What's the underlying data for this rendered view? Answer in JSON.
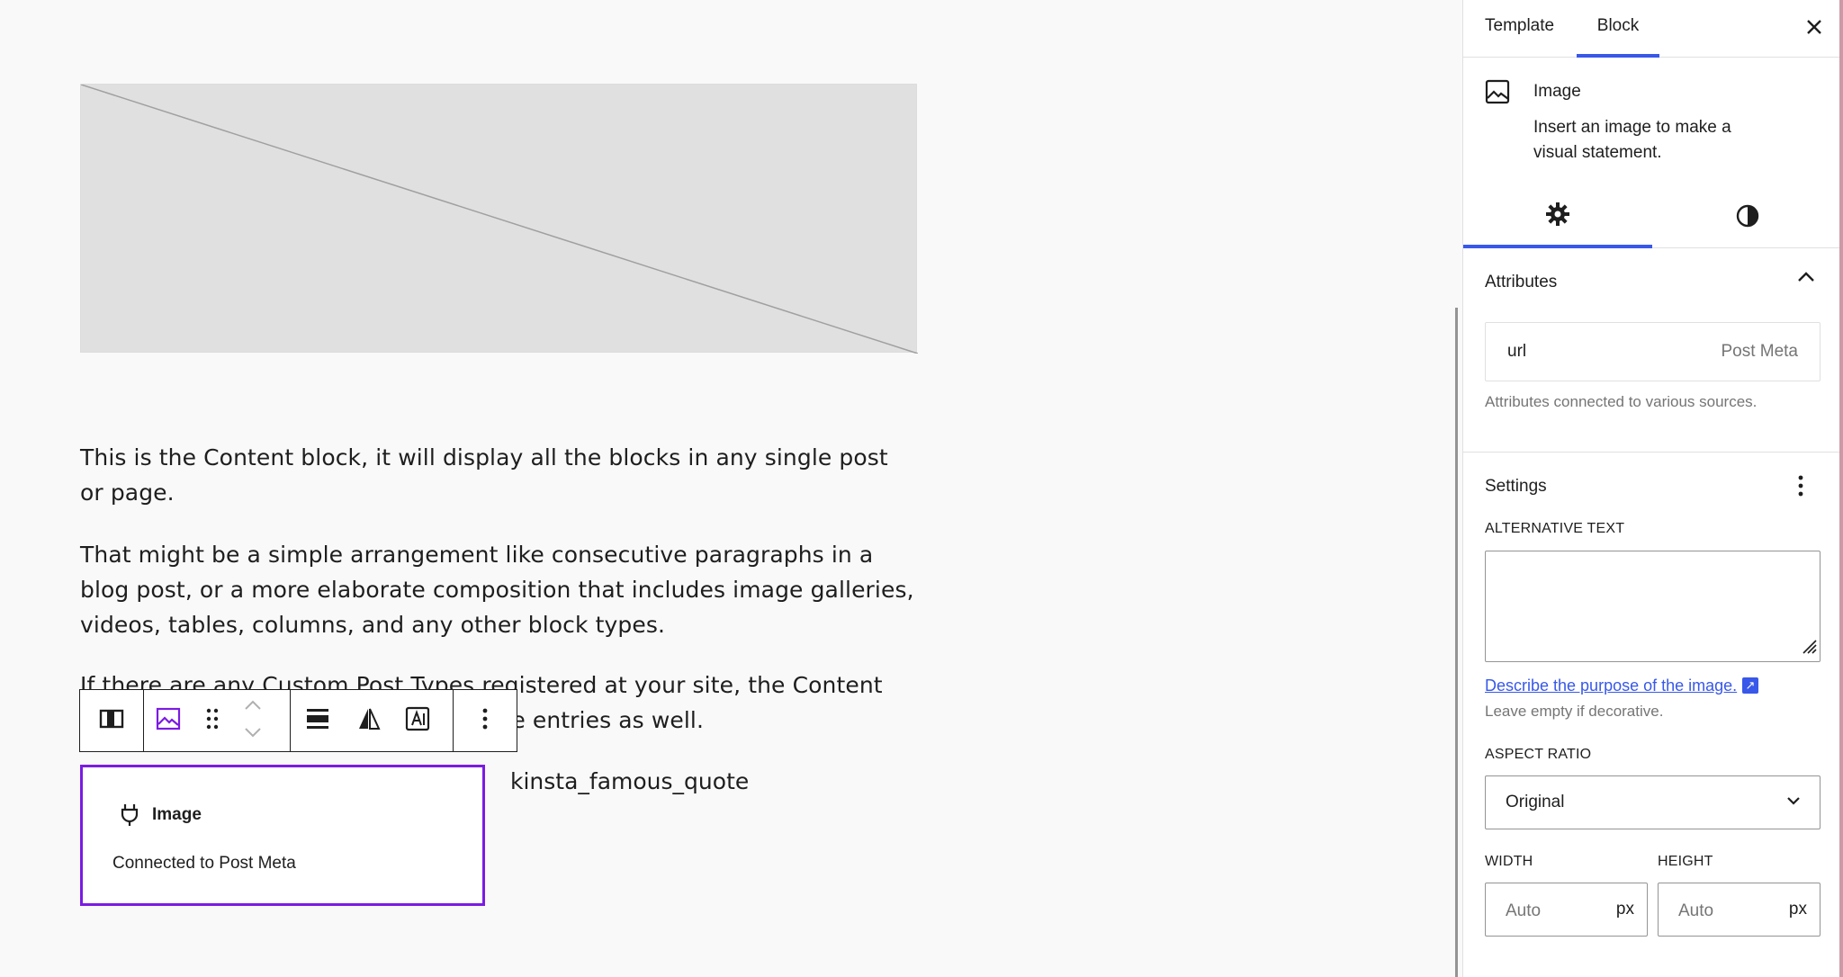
{
  "canvas": {
    "paragraphs": [
      "This is the Content block, it will display all the blocks in any single post or page.",
      "That might be a simple arrangement like consecutive paragraphs in a blog post, or a more elaborate composition that includes image galleries, videos, tables, columns, and any other block types.",
      "If there are any Custom Post Types registered at your site, the Content block can display the contents of those entries as well."
    ],
    "quote_label": "kinsta_famous_quote",
    "image_block": {
      "title": "Image",
      "description": "Connected to Post Meta"
    },
    "toolbar": {
      "icons": [
        "parent-block-icon",
        "image-icon",
        "drag-handle-icon",
        "move-up-icon",
        "move-down-icon",
        "align-icon",
        "duotone-icon",
        "text-overlay-icon",
        "more-options-icon"
      ]
    }
  },
  "sidebar": {
    "tabs": [
      "Template",
      "Block"
    ],
    "active_tab": "Block",
    "block": {
      "name": "Image",
      "description": "Insert an image to make a visual statement."
    },
    "attributes": {
      "heading": "Attributes",
      "rows": [
        {
          "key": "url",
          "source": "Post Meta"
        }
      ],
      "help": "Attributes connected to various sources."
    },
    "settings": {
      "heading": "Settings",
      "alt_label": "ALTERNATIVE TEXT",
      "alt_value": "",
      "alt_link": "Describe the purpose of the image.",
      "alt_help": "Leave empty if decorative.",
      "aspect_label": "ASPECT RATIO",
      "aspect_value": "Original",
      "width_label": "WIDTH",
      "height_label": "HEIGHT",
      "width_placeholder": "Auto",
      "height_placeholder": "Auto",
      "unit": "px"
    }
  },
  "colors": {
    "accent": "#3858e9",
    "selection": "#7b1be2",
    "placeholder_bg": "#e0e0e0"
  }
}
